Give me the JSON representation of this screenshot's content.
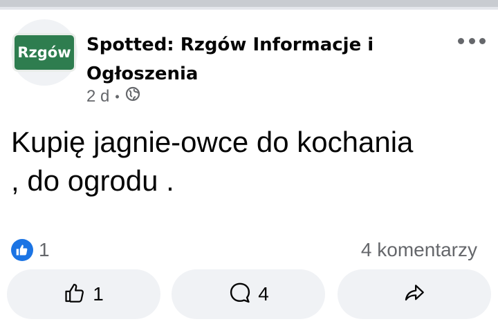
{
  "post": {
    "page_name": "Spotted: Rzgów Informacje i Ogłoszenia",
    "avatar_text": "Rzgów",
    "time": "2 d",
    "separator": "•",
    "audience_icon": "globe-icon",
    "text_line1": "Kupię jagnie-owce do kochania",
    "text_line2": ", do ogrodu ."
  },
  "stats": {
    "likes": "1",
    "comments": "4 komentarzy"
  },
  "actions": {
    "like_count": "1",
    "comment_count": "4",
    "like_icon": "thumbs-up-icon",
    "comment_icon": "comment-bubble-icon",
    "share_icon": "share-arrow-icon"
  },
  "colors": {
    "like_blue": "#1b74e4",
    "secondary_text": "#65676b",
    "button_bg": "#f0f2f5",
    "avatar_green": "#2e7d4f"
  }
}
